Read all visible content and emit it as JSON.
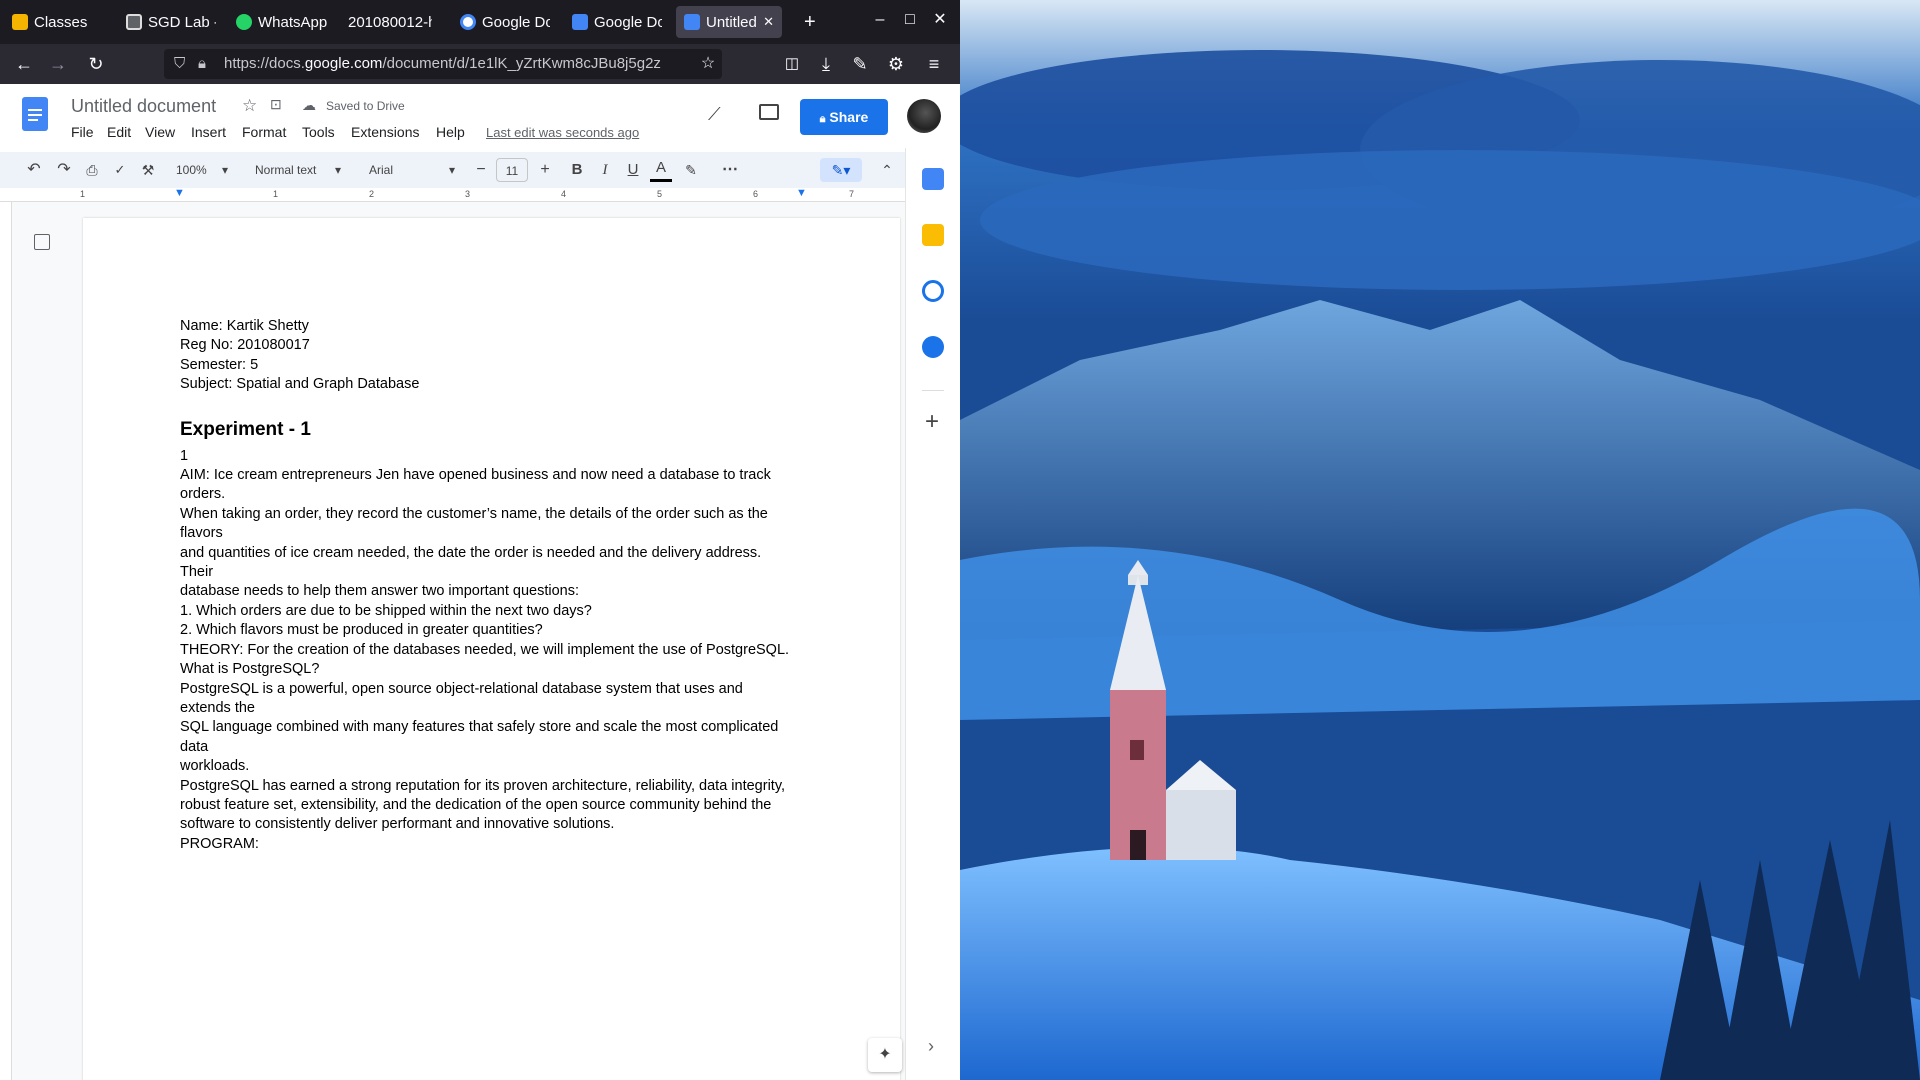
{
  "browser": {
    "tabs": [
      {
        "label": "Classes",
        "color": "#f4b400"
      },
      {
        "label": "SGD Lab -",
        "color": "#5f6368"
      },
      {
        "label": "WhatsApp",
        "color": "#25d366"
      },
      {
        "label": "201080012-h",
        "color": "#1c1b22"
      },
      {
        "label": "Google Do",
        "color": "#ffffff"
      },
      {
        "label": "Google Do",
        "color": "#4285f4"
      },
      {
        "label": "Untitled",
        "color": "#4285f4"
      }
    ],
    "new_tab": "+",
    "window_controls": {
      "minimize": "–",
      "maximize": "□",
      "close": "✕"
    },
    "url_prefix": "https://docs.",
    "url_domain": "google.com",
    "url_suffix": "/document/d/1e1lK_yZrtKwm8cJBu8j5g2z"
  },
  "docs": {
    "title": "Untitled document",
    "saved_status": "Saved to Drive",
    "menu": [
      "File",
      "Edit",
      "View",
      "Insert",
      "Format",
      "Tools",
      "Extensions",
      "Help"
    ],
    "last_edit": "Last edit was seconds ago",
    "share_label": "Share",
    "toolbar": {
      "zoom": "100%",
      "style": "Normal text",
      "font": "Arial",
      "font_size": "11",
      "bold": "B",
      "italic": "I",
      "underline": "U",
      "text_color": "A"
    },
    "ruler_marks": [
      "1",
      "1",
      "2",
      "3",
      "4",
      "5",
      "6",
      "7"
    ],
    "content": {
      "header_lines": [
        "Name: Kartik Shetty",
        "Reg No: 201080017",
        "Semester: 5",
        "Subject: Spatial and Graph Database"
      ],
      "heading": "Experiment - 1",
      "body_lines": [
        "1",
        "AIM: Ice cream entrepreneurs Jen have opened business and now need a database to track",
        "orders.",
        "When taking an order, they record the customer’s name, the details of the order such as the",
        "flavors",
        "and quantities of ice cream needed, the date the order is needed and the delivery address.",
        "Their",
        "database needs to help them answer two important questions:",
        "1. Which orders are due to be shipped within the next two days?",
        "2. Which flavors must be produced in greater quantities?",
        "THEORY: For the creation of the databases needed, we will implement the use of PostgreSQL.",
        "What is PostgreSQL?",
        "PostgreSQL is a powerful, open source object-relational database system that uses and",
        "extends the",
        "SQL language combined with many features that safely store and scale the most complicated",
        "data",
        "workloads.",
        "PostgreSQL has earned a strong reputation for its proven architecture, reliability, data integrity,",
        "robust feature set, extensibility, and the dedication of the open source community behind the",
        "software to consistently deliver performant and innovative solutions.",
        "PROGRAM:"
      ]
    },
    "side_apps": [
      "calendar-icon",
      "keep-icon",
      "tasks-icon",
      "contacts-icon"
    ],
    "add_addon": "+"
  },
  "colors": {
    "share_blue": "#1a73e8",
    "docs_blue": "#4285f4",
    "firefox_tabbar": "#1c1b22"
  }
}
